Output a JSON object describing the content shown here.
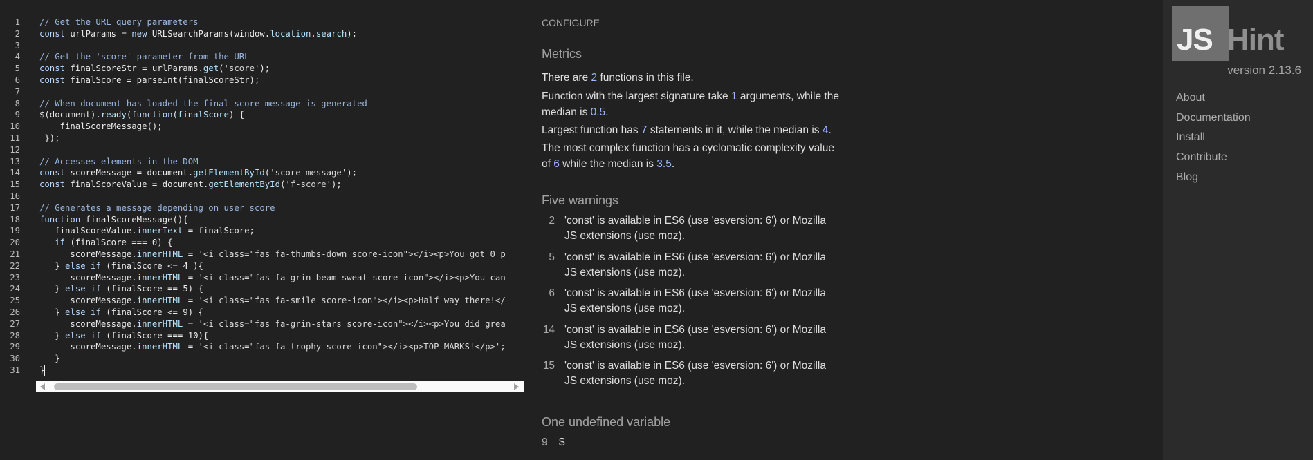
{
  "editor": {
    "lines": [
      {
        "n": "1",
        "parts": [
          {
            "t": "cm",
            "v": "// Get the URL query parameters"
          }
        ]
      },
      {
        "n": "2",
        "parts": [
          {
            "t": "kw",
            "v": "const"
          },
          {
            "t": "pl",
            "v": " urlParams = "
          },
          {
            "t": "kw",
            "v": "new"
          },
          {
            "t": "pl",
            "v": " URLSearchParams(window."
          },
          {
            "t": "pr",
            "v": "location"
          },
          {
            "t": "pl",
            "v": "."
          },
          {
            "t": "pr",
            "v": "search"
          },
          {
            "t": "pl",
            "v": ");"
          }
        ]
      },
      {
        "n": "3",
        "parts": []
      },
      {
        "n": "4",
        "parts": [
          {
            "t": "cm",
            "v": "// Get the 'score' parameter from the URL"
          }
        ]
      },
      {
        "n": "5",
        "parts": [
          {
            "t": "kw",
            "v": "const"
          },
          {
            "t": "pl",
            "v": " finalScoreStr = urlParams."
          },
          {
            "t": "pr",
            "v": "get"
          },
          {
            "t": "pl",
            "v": "("
          },
          {
            "t": "st",
            "v": "'score'"
          },
          {
            "t": "pl",
            "v": ");"
          }
        ]
      },
      {
        "n": "6",
        "parts": [
          {
            "t": "kw",
            "v": "const"
          },
          {
            "t": "pl",
            "v": " finalScore = parseInt(finalScoreStr);"
          }
        ]
      },
      {
        "n": "7",
        "parts": []
      },
      {
        "n": "8",
        "parts": [
          {
            "t": "cm",
            "v": "// When document has loaded the final score message is generated"
          }
        ]
      },
      {
        "n": "9",
        "parts": [
          {
            "t": "pl",
            "v": "$(document)."
          },
          {
            "t": "pr",
            "v": "ready"
          },
          {
            "t": "pl",
            "v": "("
          },
          {
            "t": "kw",
            "v": "function"
          },
          {
            "t": "pl",
            "v": "("
          },
          {
            "t": "pr",
            "v": "finalScore"
          },
          {
            "t": "pl",
            "v": ") {"
          }
        ]
      },
      {
        "n": "10",
        "parts": [
          {
            "t": "pl",
            "v": "    finalScoreMessage();"
          }
        ]
      },
      {
        "n": "11",
        "parts": [
          {
            "t": "pl",
            "v": " });"
          }
        ]
      },
      {
        "n": "12",
        "parts": []
      },
      {
        "n": "13",
        "parts": [
          {
            "t": "cm",
            "v": "// Accesses elements in the DOM"
          }
        ]
      },
      {
        "n": "14",
        "parts": [
          {
            "t": "kw",
            "v": "const"
          },
          {
            "t": "pl",
            "v": " scoreMessage = document."
          },
          {
            "t": "pr",
            "v": "getElementById"
          },
          {
            "t": "pl",
            "v": "("
          },
          {
            "t": "st",
            "v": "'score-message'"
          },
          {
            "t": "pl",
            "v": ");"
          }
        ]
      },
      {
        "n": "15",
        "parts": [
          {
            "t": "kw",
            "v": "const"
          },
          {
            "t": "pl",
            "v": " finalScoreValue = document."
          },
          {
            "t": "pr",
            "v": "getElementById"
          },
          {
            "t": "pl",
            "v": "("
          },
          {
            "t": "st",
            "v": "'f-score'"
          },
          {
            "t": "pl",
            "v": ");"
          }
        ]
      },
      {
        "n": "16",
        "parts": []
      },
      {
        "n": "17",
        "parts": [
          {
            "t": "cm",
            "v": "// Generates a message depending on user score"
          }
        ]
      },
      {
        "n": "18",
        "parts": [
          {
            "t": "kw",
            "v": "function"
          },
          {
            "t": "pl",
            "v": " finalScoreMessage(){"
          }
        ]
      },
      {
        "n": "19",
        "parts": [
          {
            "t": "pl",
            "v": "   finalScoreValue."
          },
          {
            "t": "pr",
            "v": "innerText"
          },
          {
            "t": "pl",
            "v": " = finalScore;"
          }
        ]
      },
      {
        "n": "20",
        "parts": [
          {
            "t": "kw",
            "v": "   if"
          },
          {
            "t": "pl",
            "v": " (finalScore === 0) {"
          }
        ]
      },
      {
        "n": "21",
        "parts": [
          {
            "t": "pl",
            "v": "      scoreMessage."
          },
          {
            "t": "pr",
            "v": "innerHTML"
          },
          {
            "t": "pl",
            "v": " = "
          },
          {
            "t": "st",
            "v": "'<i class=\"fas fa-thumbs-down score-icon\"></i><p>You got 0 p"
          }
        ]
      },
      {
        "n": "22",
        "parts": [
          {
            "t": "pl",
            "v": "   } "
          },
          {
            "t": "kw",
            "v": "else if"
          },
          {
            "t": "pl",
            "v": " (finalScore <= 4 ){"
          }
        ]
      },
      {
        "n": "23",
        "parts": [
          {
            "t": "pl",
            "v": "      scoreMessage."
          },
          {
            "t": "pr",
            "v": "innerHTML"
          },
          {
            "t": "pl",
            "v": " = "
          },
          {
            "t": "st",
            "v": "'<i class=\"fas fa-grin-beam-sweat score-icon\"></i><p>You can"
          }
        ]
      },
      {
        "n": "24",
        "parts": [
          {
            "t": "pl",
            "v": "   } "
          },
          {
            "t": "kw",
            "v": "else if"
          },
          {
            "t": "pl",
            "v": " (finalScore == 5) {"
          }
        ]
      },
      {
        "n": "25",
        "parts": [
          {
            "t": "pl",
            "v": "      scoreMessage."
          },
          {
            "t": "pr",
            "v": "innerHTML"
          },
          {
            "t": "pl",
            "v": " = "
          },
          {
            "t": "st",
            "v": "'<i class=\"fas fa-smile score-icon\"></i><p>Half way there!</"
          }
        ]
      },
      {
        "n": "26",
        "parts": [
          {
            "t": "pl",
            "v": "   } "
          },
          {
            "t": "kw",
            "v": "else if"
          },
          {
            "t": "pl",
            "v": " (finalScore <= 9) {"
          }
        ]
      },
      {
        "n": "27",
        "parts": [
          {
            "t": "pl",
            "v": "      scoreMessage."
          },
          {
            "t": "pr",
            "v": "innerHTML"
          },
          {
            "t": "pl",
            "v": " = "
          },
          {
            "t": "st",
            "v": "'<i class=\"fas fa-grin-stars score-icon\"></i><p>You did grea"
          }
        ]
      },
      {
        "n": "28",
        "parts": [
          {
            "t": "pl",
            "v": "   } "
          },
          {
            "t": "kw",
            "v": "else if"
          },
          {
            "t": "pl",
            "v": " (finalScore === 10){"
          }
        ]
      },
      {
        "n": "29",
        "parts": [
          {
            "t": "pl",
            "v": "      scoreMessage."
          },
          {
            "t": "pr",
            "v": "innerHTML"
          },
          {
            "t": "pl",
            "v": " = "
          },
          {
            "t": "st",
            "v": "'<i class=\"fas fa-trophy score-icon\"></i><p>TOP MARKS!</p>';"
          }
        ]
      },
      {
        "n": "30",
        "parts": [
          {
            "t": "pl",
            "v": "   }"
          }
        ]
      },
      {
        "n": "31",
        "parts": [
          {
            "t": "pl",
            "v": "}"
          }
        ]
      }
    ]
  },
  "report": {
    "configure": "CONFIGURE",
    "metrics_title": "Metrics",
    "metrics": {
      "p1_a": "There are ",
      "p1_n": "2",
      "p1_b": " functions in this file.",
      "p2_a": "Function with the largest signature take ",
      "p2_n1": "1",
      "p2_b": " arguments, while the median is ",
      "p2_n2": "0.5",
      "p2_c": ".",
      "p3_a": "Largest function has ",
      "p3_n1": "7",
      "p3_b": " statements in it, while the median is ",
      "p3_n2": "4",
      "p3_c": ".",
      "p4_a": "The most complex function has a cyclomatic complexity value of ",
      "p4_n1": "6",
      "p4_b": " while the median is ",
      "p4_n2": "3.5",
      "p4_c": "."
    },
    "warnings_title": "Five warnings",
    "warnings": [
      {
        "line": "2",
        "text": "'const' is available in ES6 (use 'esversion: 6') or Mozilla JS extensions (use moz)."
      },
      {
        "line": "5",
        "text": "'const' is available in ES6 (use 'esversion: 6') or Mozilla JS extensions (use moz)."
      },
      {
        "line": "6",
        "text": "'const' is available in ES6 (use 'esversion: 6') or Mozilla JS extensions (use moz)."
      },
      {
        "line": "14",
        "text": "'const' is available in ES6 (use 'esversion: 6') or Mozilla JS extensions (use moz)."
      },
      {
        "line": "15",
        "text": "'const' is available in ES6 (use 'esversion: 6') or Mozilla JS extensions (use moz)."
      }
    ],
    "undefined_title": "One undefined variable",
    "undefined": {
      "line": "9",
      "name": "$"
    }
  },
  "sidebar": {
    "logo_js": "JS",
    "logo_hint": "Hint",
    "version": "version 2.13.6",
    "nav": [
      "About",
      "Documentation",
      "Install",
      "Contribute",
      "Blog"
    ]
  }
}
